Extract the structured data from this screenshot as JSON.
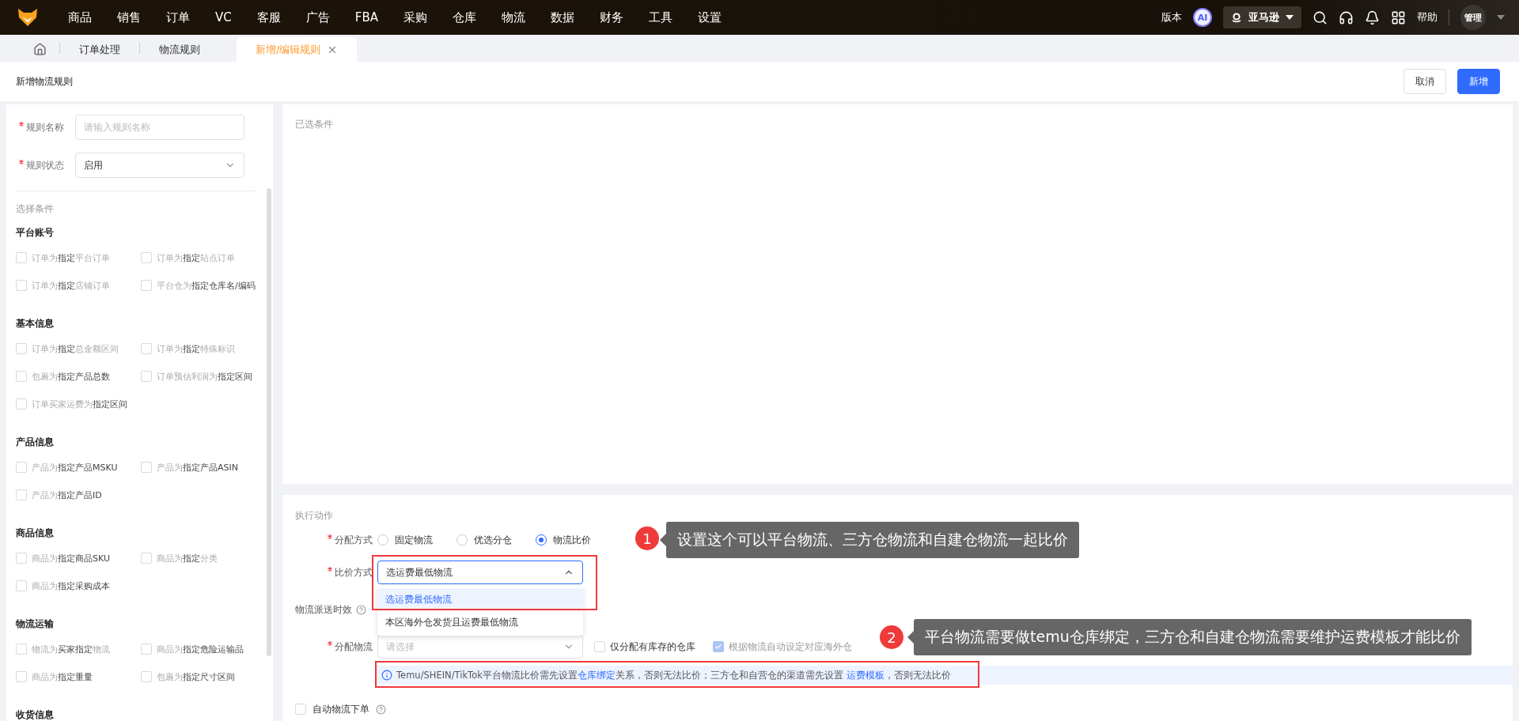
{
  "top_nav": {
    "menu": [
      "商品",
      "销售",
      "订单",
      "VC",
      "客服",
      "广告",
      "FBA",
      "采购",
      "仓库",
      "物流",
      "数据",
      "财务",
      "工具",
      "设置"
    ],
    "version": "版本",
    "ai_badge": "AI",
    "store": "亚马逊",
    "help": "帮助",
    "user": "管理"
  },
  "tabs": [
    {
      "label": "订单处理",
      "selected": false,
      "closable": false
    },
    {
      "label": "物流规则",
      "selected": false,
      "closable": false
    },
    {
      "label": "新增/编辑规则",
      "selected": true,
      "closable": true
    }
  ],
  "header": {
    "title": "新增物流规则",
    "buttons": [
      {
        "label": "取消",
        "kind": "default"
      },
      {
        "label": "新增",
        "kind": "primary"
      }
    ]
  },
  "rule_fields": [
    {
      "label": "规则名称",
      "required": true,
      "kind": "input",
      "placeholder": "请输入规则名称"
    },
    {
      "label": "规则状态",
      "required": true,
      "kind": "select",
      "value": "启用"
    }
  ],
  "conditions": {
    "title": "选择条件",
    "groups": [
      {
        "title": "平台账号",
        "items": [
          {
            "label": "订单为**指定**平台订单",
            "checked": false
          },
          {
            "label": "订单为**指定**站点订单",
            "checked": false
          },
          {
            "label": "订单为**指定**店铺订单",
            "checked": false
          },
          {
            "label": "平台仓为**指定仓库名/编码**",
            "checked": false
          }
        ]
      },
      {
        "title": "基本信息",
        "items": [
          {
            "label": "订单为**指定**总金额区间",
            "checked": false
          },
          {
            "label": "订单为**指定**特殊标识",
            "checked": false
          },
          {
            "label": "包裹为**指定产品总数**",
            "checked": false
          },
          {
            "label": "订单预估利润为**指定区间**",
            "checked": false
          },
          {
            "label": "订单买家运费为**指定区间**",
            "checked": false
          }
        ]
      },
      {
        "title": "产品信息",
        "items": [
          {
            "label": "产品为**指定产品MSKU**",
            "checked": false
          },
          {
            "label": "产品为**指定产品ASIN**",
            "checked": false
          },
          {
            "label": "产品为**指定产品ID**",
            "checked": false
          }
        ]
      },
      {
        "title": "商品信息",
        "items": [
          {
            "label": "商品为**指定商品SKU**",
            "checked": false
          },
          {
            "label": "商品为**指定**分类",
            "checked": false
          },
          {
            "label": "商品为**指定采购成本**",
            "checked": false
          }
        ]
      },
      {
        "title": "物流运输",
        "items": [
          {
            "label": "物流为**买家指定**物流",
            "checked": false
          },
          {
            "label": "商品为**指定危险运输品**",
            "checked": false
          },
          {
            "label": "商品为**指定重量**",
            "checked": false
          },
          {
            "label": "包裹为**指定尺寸区间**",
            "checked": false
          }
        ]
      },
      {
        "title": "收货信息"
      }
    ]
  },
  "selected_conditions": {
    "title": "已选条件"
  },
  "action": {
    "title": "执行动作",
    "assign_mode": {
      "label": "分配方式",
      "required": true,
      "options": [
        {
          "label": "固定物流",
          "selected": false
        },
        {
          "label": "优选分仓",
          "selected": false
        },
        {
          "label": "物流比价",
          "selected": true
        }
      ]
    },
    "compare_mode": {
      "label": "比价方式",
      "required": true,
      "value": "选运费最低物流",
      "expanded": true,
      "options": [
        {
          "label": "选运费最低物流",
          "selected": true
        },
        {
          "label": "本区海外仓发货且运费最低物流",
          "selected": false
        }
      ]
    },
    "delivery_time": {
      "label": "物流派送时效"
    },
    "assign_logistics": {
      "label": "分配物流",
      "required": true,
      "placeholder": "请选择",
      "checkboxes": [
        {
          "label": "仅分配有库存的仓库",
          "checked": false,
          "disabled": false
        },
        {
          "label": "根据物流自动设定对应海外仓",
          "checked": true,
          "disabled": true
        }
      ]
    },
    "notice": [
      {
        "text": "Temu/SHEIN/TikTok平台物流比价需先设置",
        "link": false
      },
      {
        "text": "仓库绑定",
        "link": true
      },
      {
        "text": "关系，否则无法比价；三方仓和自营仓的渠道需先设置 ",
        "link": false
      },
      {
        "text": "运费模板",
        "link": true
      },
      {
        "text": "，否则无法比价",
        "link": false
      }
    ],
    "auto_order": {
      "label": "自动物流下单",
      "checked": false
    }
  },
  "annotations": [
    {
      "number": "1",
      "text": "设置这个可以平台物流、三方仓物流和自建仓物流一起比价"
    },
    {
      "number": "2",
      "text": "平台物流需要做temu仓库绑定，三方仓和自建仓物流需要维护运费模板才能比价"
    }
  ]
}
